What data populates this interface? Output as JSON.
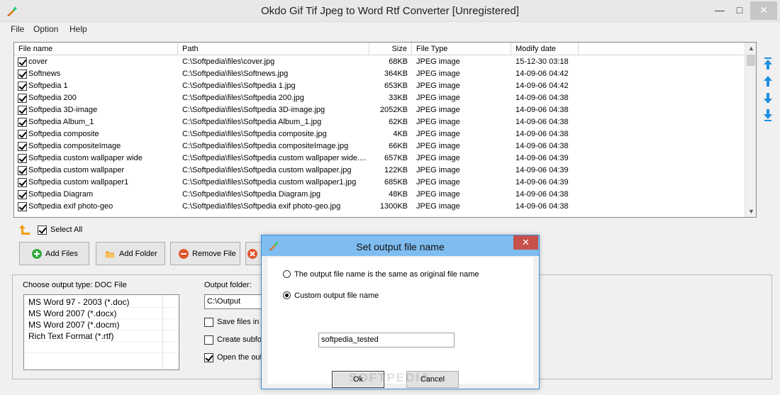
{
  "window": {
    "title": "Okdo Gif Tif Jpeg to Word Rtf Converter [Unregistered]",
    "min_glyph": "—",
    "max_glyph": "□",
    "close_glyph": "✕"
  },
  "menu": [
    "File",
    "Option",
    "Help"
  ],
  "file_list": {
    "columns": [
      "File name",
      "Path",
      "Size",
      "File Type",
      "Modify date"
    ],
    "rows": [
      {
        "name": "cover",
        "path": "C:\\Softpedia\\files\\cover.jpg",
        "size": "68KB",
        "type": "JPEG image",
        "date": "15-12-30 03:18"
      },
      {
        "name": "Softnews",
        "path": "C:\\Softpedia\\files\\Softnews.jpg",
        "size": "364KB",
        "type": "JPEG image",
        "date": "14-09-06 04:42"
      },
      {
        "name": "Softpedia 1",
        "path": "C:\\Softpedia\\files\\Softpedia 1.jpg",
        "size": "653KB",
        "type": "JPEG image",
        "date": "14-09-06 04:42"
      },
      {
        "name": "Softpedia 200",
        "path": "C:\\Softpedia\\files\\Softpedia 200.jpg",
        "size": "33KB",
        "type": "JPEG image",
        "date": "14-09-06 04:38"
      },
      {
        "name": "Softpedia 3D-image",
        "path": "C:\\Softpedia\\files\\Softpedia 3D-image.jpg",
        "size": "2052KB",
        "type": "JPEG image",
        "date": "14-09-06 04:38"
      },
      {
        "name": "Softpedia Album_1",
        "path": "C:\\Softpedia\\files\\Softpedia Album_1.jpg",
        "size": "62KB",
        "type": "JPEG image",
        "date": "14-09-06 04:38"
      },
      {
        "name": "Softpedia composite",
        "path": "C:\\Softpedia\\files\\Softpedia composite.jpg",
        "size": "4KB",
        "type": "JPEG image",
        "date": "14-09-06 04:38"
      },
      {
        "name": "Softpedia compositeImage",
        "path": "C:\\Softpedia\\files\\Softpedia compositeImage.jpg",
        "size": "66KB",
        "type": "JPEG image",
        "date": "14-09-06 04:38"
      },
      {
        "name": "Softpedia custom wallpaper wide",
        "path": "C:\\Softpedia\\files\\Softpedia custom wallpaper wide....",
        "size": "657KB",
        "type": "JPEG image",
        "date": "14-09-06 04:39"
      },
      {
        "name": "Softpedia custom wallpaper",
        "path": "C:\\Softpedia\\files\\Softpedia custom wallpaper.jpg",
        "size": "122KB",
        "type": "JPEG image",
        "date": "14-09-06 04:39"
      },
      {
        "name": "Softpedia custom wallpaper1",
        "path": "C:\\Softpedia\\files\\Softpedia custom wallpaper1.jpg",
        "size": "685KB",
        "type": "JPEG image",
        "date": "14-09-06 04:39"
      },
      {
        "name": "Softpedia Diagram",
        "path": "C:\\Softpedia\\files\\Softpedia Diagram.jpg",
        "size": "48KB",
        "type": "JPEG image",
        "date": "14-09-06 04:38"
      },
      {
        "name": "Softpedia exif photo-geo",
        "path": "C:\\Softpedia\\files\\Softpedia exif photo-geo.jpg",
        "size": "1300KB",
        "type": "JPEG image",
        "date": "14-09-06 04:38"
      }
    ]
  },
  "select_all_label": "Select All",
  "buttons": {
    "add_files": "Add Files",
    "add_folder": "Add Folder",
    "remove_file": "Remove File"
  },
  "output": {
    "type_label": "Choose output type:  DOC File",
    "types": [
      "MS Word 97 - 2003 (*.doc)",
      "MS Word 2007 (*.docx)",
      "MS Word 2007 (*.docm)",
      "Rich Text Format (*.rtf)"
    ],
    "folder_label": "Output folder:",
    "folder_value": "C:\\Output",
    "opt_save": "Save files in",
    "opt_create": "Create subfo",
    "opt_open": "Open the out"
  },
  "dialog": {
    "title": "Set output file name",
    "close_glyph": "✕",
    "option_same": "The output file name is the same as original file name",
    "option_custom": "Custom output file name",
    "custom_value": "softpedia_tested",
    "ok_label": "Ok",
    "cancel_label": "Cancel",
    "watermark": "SOFTPEDIA"
  },
  "colors": {
    "dialog_title_bg": "#7fbdf0",
    "dialog_close_bg": "#c7504a",
    "accent_blue": "#1e8fe0"
  }
}
